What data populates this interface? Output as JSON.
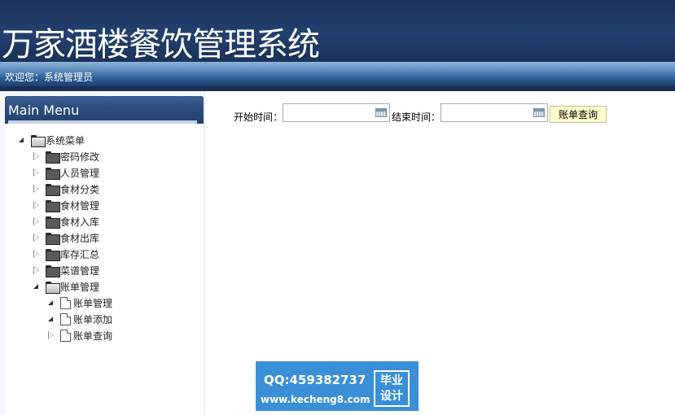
{
  "header": {
    "title": "万家酒楼餐饮管理系统",
    "welcome": "欢迎您：系统管理员"
  },
  "sidebar": {
    "title": "Main Menu",
    "root": {
      "label": "系统菜单",
      "expanded": true
    },
    "items": [
      {
        "label": "密码修改",
        "expanded": false
      },
      {
        "label": "人员管理",
        "expanded": false
      },
      {
        "label": "食材分类",
        "expanded": false
      },
      {
        "label": "食材管理",
        "expanded": false
      },
      {
        "label": "食材入库",
        "expanded": false
      },
      {
        "label": "食材出库",
        "expanded": false
      },
      {
        "label": "库存汇总",
        "expanded": false
      },
      {
        "label": "菜谱管理",
        "expanded": false
      },
      {
        "label": "账单管理",
        "expanded": true
      }
    ],
    "subitems": [
      {
        "label": "账单管理"
      },
      {
        "label": "账单添加"
      },
      {
        "label": "账单查询"
      }
    ]
  },
  "search": {
    "start_label": "开始时间：",
    "start_value": "",
    "end_label": "结束时间：",
    "end_value": "",
    "button_label": "账单查询"
  },
  "watermark": {
    "qq": "QQ:459382737",
    "site": "www.kecheng8.com",
    "badge_line1": "毕业",
    "badge_line2": "设计"
  },
  "colors": {
    "header_bg": "#1b3259",
    "button_bg": "#ffffcc",
    "watermark_bg": "#3a8fd6"
  }
}
